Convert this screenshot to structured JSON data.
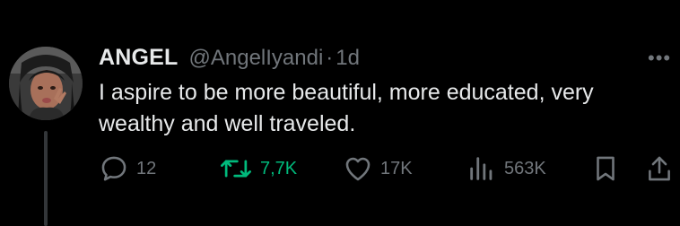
{
  "tweet": {
    "author_name": "ANGEL",
    "handle": "@AngelIyandi",
    "separator": "·",
    "age": "1d",
    "text": "I aspire to be more beautiful, more educated, very wealthy and well traveled.",
    "more_glyph": "•••"
  },
  "actions": {
    "replies": "12",
    "retweets": "7,7K",
    "likes": "17K",
    "views": "563K"
  },
  "colors": {
    "background": "#000000",
    "text": "#e7e9ea",
    "secondary": "#71767b",
    "retweet_active": "#00ba7c"
  },
  "icons": {
    "reply": "reply-icon",
    "retweet": "retweet-icon",
    "like": "heart-icon",
    "views": "views-icon",
    "bookmark": "bookmark-icon",
    "share": "share-icon"
  }
}
